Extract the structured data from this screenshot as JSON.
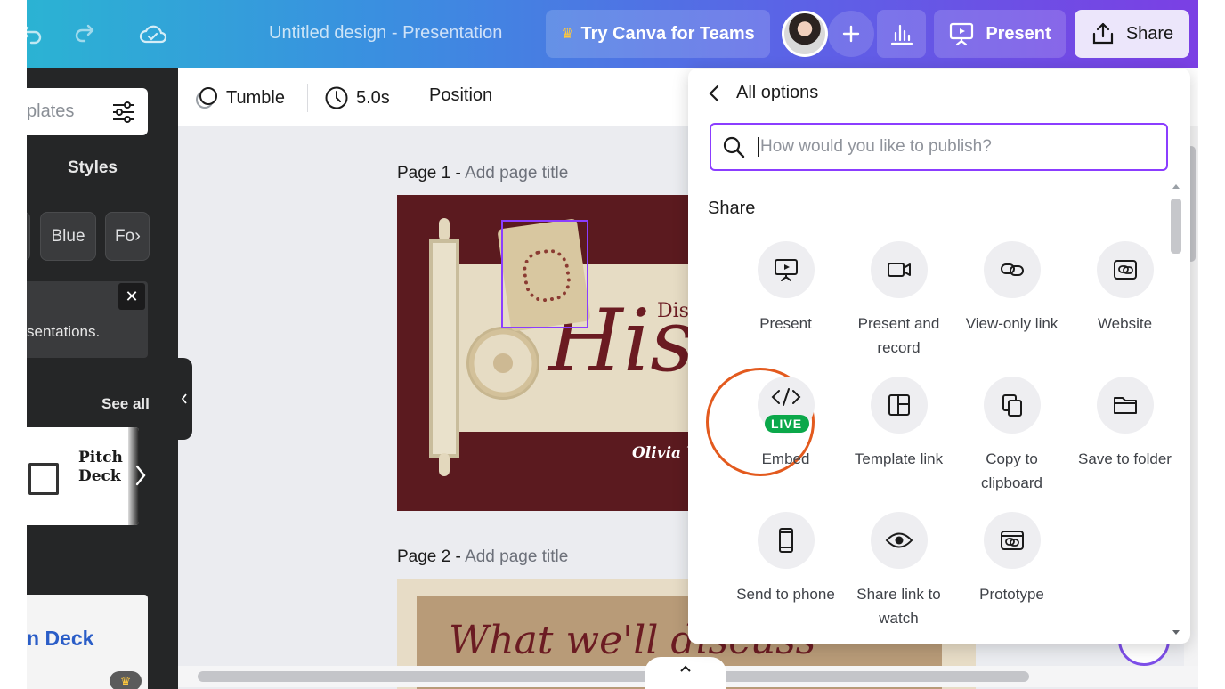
{
  "topbar": {
    "title": "Untitled design - Presentation",
    "teams_label": "Try Canva for Teams",
    "present_label": "Present",
    "share_label": "Share"
  },
  "leftpanel": {
    "search_text": "plates",
    "styles_heading": "Styles",
    "chips": [
      "Blue",
      "Fo"
    ],
    "notice_text": "sentations.",
    "close_symbol": "✕",
    "see_all": "See all",
    "template1_title_line1": "Pitch",
    "template1_title_line2": "Deck",
    "template2_title": "n Deck"
  },
  "toolbar": {
    "transition": "Tumble",
    "duration": "5.0s",
    "position": "Position"
  },
  "canvas": {
    "page1_label": "Page 1 - ",
    "page1_title_placeholder": "Add page title",
    "page2_label": "Page 2 - ",
    "page2_title_placeholder": "Add page title",
    "slide1_title": "His",
    "slide1_subtitle": "Disc",
    "slide1_author": "Olivia W",
    "slide2_title": "What we'll discuss"
  },
  "share_panel": {
    "back_label": "All options",
    "search_placeholder": "How would you like to publish?",
    "section_heading": "Share",
    "live_badge": "LIVE",
    "options": [
      {
        "label": "Present",
        "icon": "present-icon"
      },
      {
        "label": "Present and record",
        "icon": "video-camera-icon"
      },
      {
        "label": "View-only link",
        "icon": "link-icon"
      },
      {
        "label": "Website",
        "icon": "website-icon"
      },
      {
        "label": "Embed",
        "icon": "code-icon"
      },
      {
        "label": "Template link",
        "icon": "template-layout-icon"
      },
      {
        "label": "Copy to clipboard",
        "icon": "copy-icon"
      },
      {
        "label": "Save to folder",
        "icon": "folder-icon"
      },
      {
        "label": "Send to phone",
        "icon": "phone-icon"
      },
      {
        "label": "Share link to watch",
        "icon": "eye-icon"
      },
      {
        "label": "Prototype",
        "icon": "prototype-icon"
      }
    ]
  },
  "colors": {
    "accent": "#8b3dff",
    "highlight": "#e35a1e",
    "live": "#0ba84a"
  }
}
